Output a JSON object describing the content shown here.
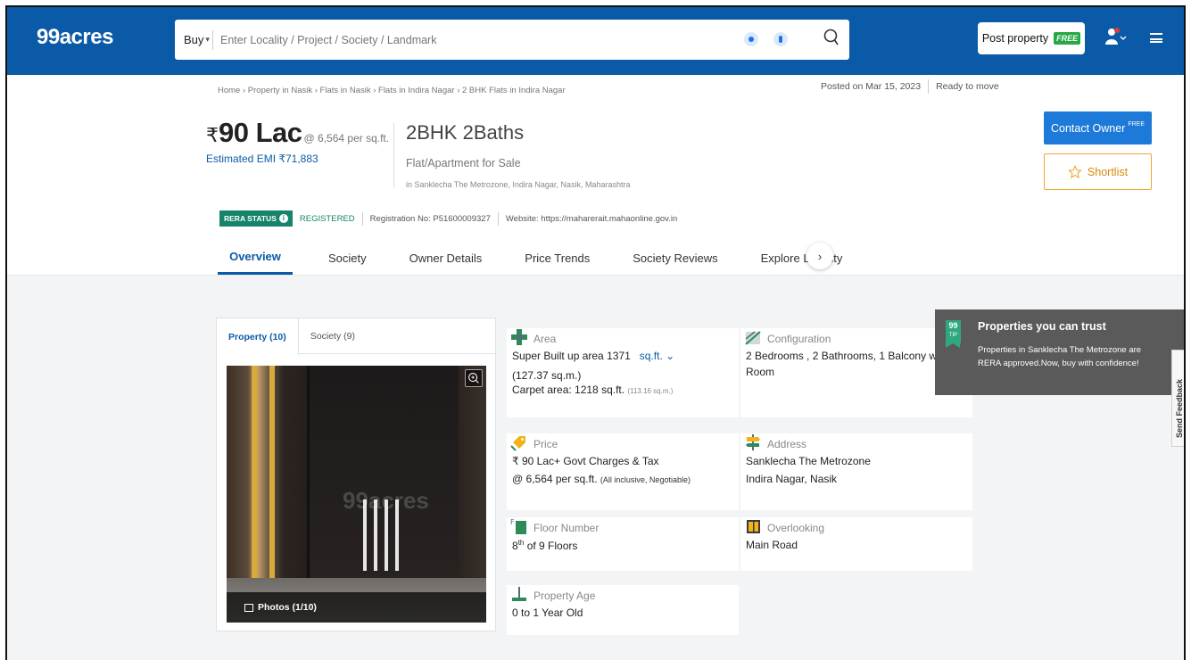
{
  "header": {
    "logo": "99acres",
    "buy_label": "Buy",
    "search_placeholder": "Enter Locality / Project / Society / Landmark",
    "post_property_label": "Post property",
    "free_badge": "FREE"
  },
  "breadcrumb": "Home › Property in Nasik › Flats in Nasik › Flats in Indira Nagar › 2 BHK Flats in Indira Nagar",
  "posted_on": "Posted on Mar 15, 2023",
  "ready_status": "Ready to move",
  "listing": {
    "rupee": "₹",
    "price": "90 Lac",
    "price_per_sqft": "@ 6,564 per sq.ft.",
    "emi": "Estimated EMI ₹71,883",
    "config_title": "2BHK 2Baths",
    "config_subtitle": "Flat/Apartment for Sale",
    "config_location": "in Sanklecha The Metrozone, Indira Nagar, Nasik, Maharashtra"
  },
  "actions": {
    "contact_owner": "Contact Owner",
    "contact_free": "FREE",
    "shortlist": "Shortlist"
  },
  "rera": {
    "status_label": "RERA STATUS",
    "info_glyph": "i",
    "registered": "REGISTERED",
    "registration": "Registration No: P51600009327",
    "website": "Website: https://maharerait.mahaonline.gov.in"
  },
  "tabs": [
    "Overview",
    "Society",
    "Owner Details",
    "Price Trends",
    "Society Reviews",
    "Explore Locality"
  ],
  "tab_next_glyph": "›",
  "gallery": {
    "tab_property": "Property (10)",
    "tab_society": "Society (9)",
    "watermark": "99acres",
    "photos_label": "Photos (1/10)"
  },
  "details": {
    "area": {
      "label": "Area",
      "line1": "Super Built up area 1371",
      "unit": "sq.ft.",
      "sub": "(127.37 sq.m.)",
      "carpet": "Carpet area: 1218 sq.ft.",
      "carpet_sub": "(113.16 sq.m.)"
    },
    "configuration": {
      "label": "Configuration",
      "line1": "2 Bedrooms , 2 Bathrooms, 1 Balcony with",
      "line2": "Room"
    },
    "price": {
      "label": "Price",
      "line1": "₹ 90 Lac+ Govt Charges & Tax",
      "line2": "@ 6,564 per sq.ft.",
      "line2_sub": "(All inclusive, Negotiable)"
    },
    "address": {
      "label": "Address",
      "line1": "Sanklecha The Metrozone",
      "line2": "Indira Nagar, Nasik"
    },
    "floor": {
      "label": "Floor Number",
      "floor_num": "8",
      "floor_sup": "th",
      "floor_rest": " of 9 Floors"
    },
    "overlooking": {
      "label": "Overlooking",
      "line1": "Main Road"
    },
    "age": {
      "label": "Property Age",
      "line1": "0 to 1 Year Old"
    }
  },
  "trust": {
    "tip_num": "99",
    "tip_word": "TIP",
    "title": "Properties you can trust",
    "body": "Properties in Sanklecha The Metrozone are RERA approved.Now, buy with confidence!"
  },
  "feedback_label": "Send Feedback",
  "colors": {
    "header_blue": "#0b5aa8",
    "rera_green": "#15846a",
    "shortlist_orange": "#f0a730",
    "contact_blue": "#1d7ad8"
  }
}
